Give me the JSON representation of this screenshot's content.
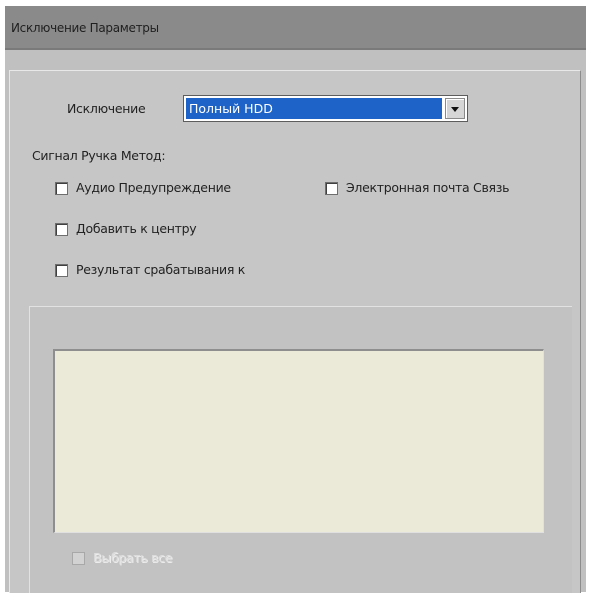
{
  "window": {
    "title": "Исключение Параметры"
  },
  "exception": {
    "label": "Исключение",
    "selected_value": "Полный HDD"
  },
  "signal_method": {
    "label": "Сигнал Ручка Метод:",
    "options": [
      {
        "label": "Аудио Предупреждение",
        "checked": false
      },
      {
        "label": "Электронная почта Связь",
        "checked": false
      },
      {
        "label": "Добавить к центру",
        "checked": false
      },
      {
        "label": "Результат срабатывания к",
        "checked": false
      }
    ]
  },
  "select_all": {
    "label": "Выбрать все",
    "checked": false,
    "enabled": false
  },
  "icons": {
    "dropdown": "chevron-down-icon"
  },
  "colors": {
    "title_bar": "#8a8a8a",
    "panel": "#c6c6c6",
    "selection": "#1e64c8",
    "textarea": "#ebe9d7"
  }
}
